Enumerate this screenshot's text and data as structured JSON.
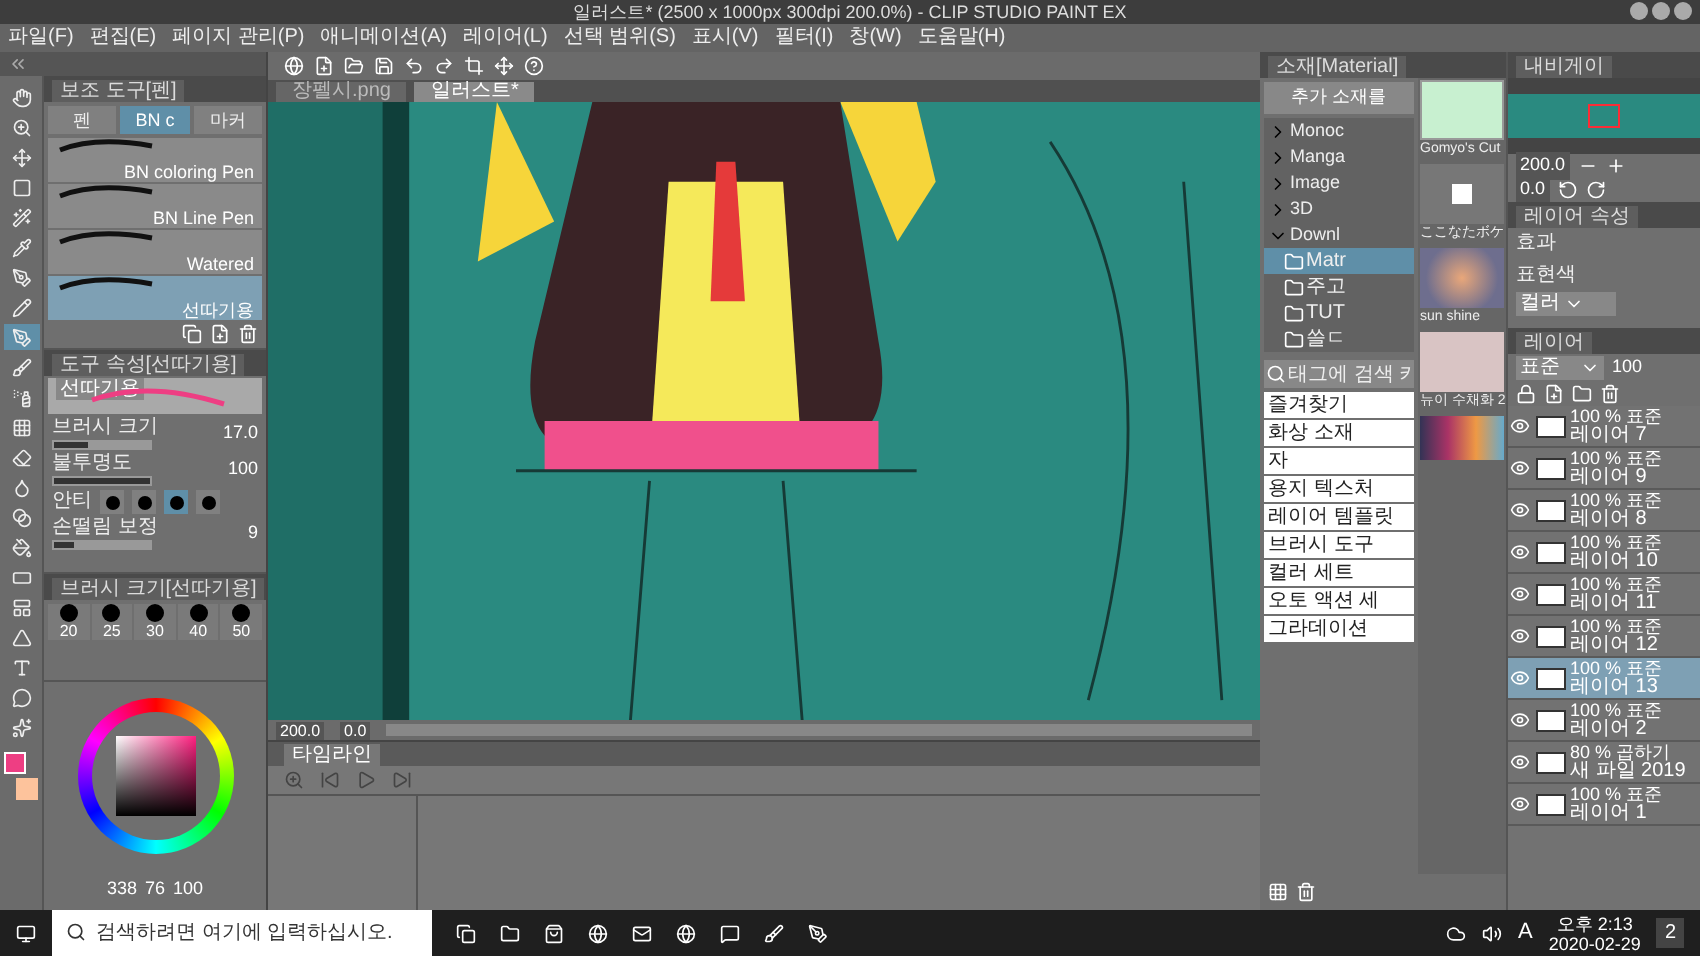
{
  "window": {
    "title": "일러스트* (2500 x 1000px 300dpi 200.0%) - CLIP STUDIO PAINT EX"
  },
  "menu": [
    "파일(F)",
    "편집(E)",
    "페이지 관리(P)",
    "애니메이션(A)",
    "레이어(L)",
    "선택 범위(S)",
    "표시(V)",
    "필터(I)",
    "창(W)",
    "도움말(H)"
  ],
  "tools": [
    {
      "kind": "hand",
      "selected": false
    },
    {
      "kind": "zoom",
      "selected": false
    },
    {
      "kind": "move",
      "selected": false
    },
    {
      "kind": "select",
      "selected": false
    },
    {
      "kind": "wand",
      "selected": false
    },
    {
      "kind": "eyedropper",
      "selected": false
    },
    {
      "kind": "pen",
      "selected": false
    },
    {
      "kind": "pencil",
      "selected": false
    },
    {
      "kind": "pen",
      "selected": true
    },
    {
      "kind": "brush",
      "selected": false
    },
    {
      "kind": "spray",
      "selected": false
    },
    {
      "kind": "pattern",
      "selected": false
    },
    {
      "kind": "eraser",
      "selected": false
    },
    {
      "kind": "blend",
      "selected": false
    },
    {
      "kind": "gradient",
      "selected": false
    },
    {
      "kind": "fill",
      "selected": false
    },
    {
      "kind": "rect",
      "selected": false
    },
    {
      "kind": "frame",
      "selected": false
    },
    {
      "kind": "ruler",
      "selected": false
    },
    {
      "kind": "text",
      "selected": false
    },
    {
      "kind": "balloon",
      "selected": false
    },
    {
      "kind": "correct",
      "selected": false
    }
  ],
  "sub_tool": {
    "title": "보조 도구[펜]",
    "tabs": [
      {
        "label": "펜",
        "selected": false
      },
      {
        "label": "BN c",
        "selected": true
      },
      {
        "label": "마커",
        "selected": false
      }
    ],
    "brushes": [
      {
        "name": "BN coloring Pen",
        "selected": false
      },
      {
        "name": "BN Line Pen",
        "selected": false
      },
      {
        "name": "Watered",
        "selected": false
      },
      {
        "name": "선따기용",
        "selected": true
      }
    ]
  },
  "tool_property": {
    "title": "도구 속성[선따기용]",
    "preview_label": "선따기용",
    "rows": [
      {
        "kind": "slider",
        "label": "브러시 크기",
        "value": "17.0",
        "level": 0.35
      },
      {
        "kind": "slider",
        "label": "불투명도",
        "value": "100",
        "level": 1
      },
      {
        "kind": "anti",
        "label": "안티",
        "options": [
          {
            "selected": false
          },
          {
            "selected": false
          },
          {
            "selected": true
          },
          {
            "selected": false
          }
        ]
      },
      {
        "kind": "slider",
        "label": "손떨림 보정",
        "value": "9",
        "level": 0.2
      }
    ]
  },
  "brush_size": {
    "title": "브러시 크기[선따기용]",
    "sizes": [
      "20",
      "25",
      "30",
      "40",
      "50"
    ]
  },
  "color": {
    "values": [
      "338",
      "76",
      "100"
    ]
  },
  "canvas": {
    "tabs": [
      {
        "label": "장펠시.png",
        "selected": false
      },
      {
        "label": "일러스트*",
        "selected": true
      }
    ],
    "zoom": "200.0",
    "angle": "0.0"
  },
  "timeline": {
    "tabs": [
      {
        "label": "타임라인",
        "selected": true
      }
    ]
  },
  "material": {
    "title": "소재[Material]",
    "add_button": "추가 소재를",
    "tree": [
      {
        "label": "Monoc",
        "expanded": false
      },
      {
        "label": "Manga",
        "expanded": false
      },
      {
        "label": "Image",
        "expanded": false
      },
      {
        "label": "3D",
        "expanded": false
      },
      {
        "label": "Downl",
        "expanded": true,
        "children": [
          {
            "label": "Matr",
            "selected": true
          },
          {
            "label": "주고",
            "selected": false
          },
          {
            "label": "TUT",
            "selected": false
          },
          {
            "label": "쓸ㄷ",
            "selected": false
          }
        ]
      }
    ],
    "search_placeholder": "태그에 검색 키",
    "tags": [
      "즐겨찾기",
      "화상 소재",
      "자",
      "용지 텍스처",
      "레이어 템플릿",
      "브러시 도구",
      "컬러 세트",
      "오토 액션 세",
      "그라데이션"
    ],
    "thumbnails": [
      {
        "kind": "sketch",
        "caption": "Gomyo's Cut"
      },
      {
        "kind": "dice",
        "caption": "ここなたボケ"
      },
      {
        "kind": "glow",
        "caption": "sun shine"
      },
      {
        "kind": "portrait",
        "caption": "뉴이 수채화 2"
      },
      {
        "kind": "palette"
      }
    ]
  },
  "navigator": {
    "title": "내비게이",
    "zoom": "200.0",
    "angle": "0.0"
  },
  "layer_property": {
    "title": "레이어 속성",
    "effect_label": "효과",
    "color_label": "표현색",
    "color_mode": "컬러"
  },
  "layers": {
    "title": "레이어",
    "blend": "표준",
    "opacity": "100",
    "items": [
      {
        "mode": "100 % 표준",
        "name": "레이어 7",
        "selected": false,
        "visible": true
      },
      {
        "mode": "100 % 표준",
        "name": "레이어 9",
        "selected": false,
        "visible": true
      },
      {
        "mode": "100 % 표준",
        "name": "레이어 8",
        "selected": false,
        "visible": true
      },
      {
        "mode": "100 % 표준",
        "name": "레이어 10",
        "selected": false,
        "visible": true
      },
      {
        "mode": "100 % 표준",
        "name": "레이어 11",
        "selected": false,
        "visible": true
      },
      {
        "mode": "100 % 표준",
        "name": "레이어 12",
        "selected": false,
        "visible": true
      },
      {
        "mode": "100 % 표준",
        "name": "레이어 13",
        "selected": true,
        "visible": true
      },
      {
        "mode": "100 % 표준",
        "name": "레이어 2",
        "selected": false,
        "visible": true
      },
      {
        "mode": "80 % 곱하기",
        "name": "새 파일 2019",
        "selected": false,
        "visible": true
      },
      {
        "mode": "100 % 표준",
        "name": "레이어 1",
        "selected": false,
        "visible": true
      }
    ]
  },
  "taskbar": {
    "search_placeholder": "검색하려면 여기에 입력하십시오.",
    "ime": "A",
    "time": "오후 2:13",
    "date": "2020-02-29",
    "notifications": "2"
  }
}
